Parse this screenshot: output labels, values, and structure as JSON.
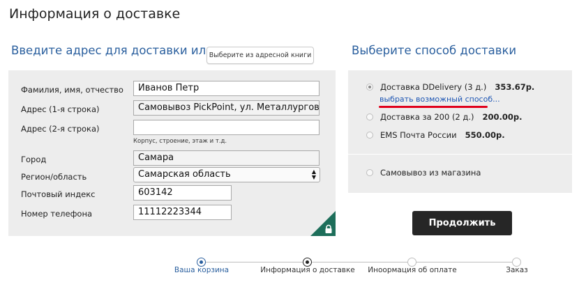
{
  "page_title": "Информация о доставке",
  "address": {
    "heading": "Введите адрес для доставки или",
    "address_book_button": "Выберите из адресной книги",
    "fields": {
      "name": {
        "label": "Фамилия, имя, отчество",
        "value": "Иванов Петр"
      },
      "address1": {
        "label": "Адрес (1-я строка)",
        "value": "Самовывоз PickPoint, ул. Металлургов,"
      },
      "address2": {
        "label": "Адрес (2-я строка)",
        "value": "",
        "hint": "Корпус, строение, этаж и т.д."
      },
      "city": {
        "label": "Город",
        "value": "Самара"
      },
      "region": {
        "label": "Регион/область",
        "value": "Самарская область"
      },
      "zip": {
        "label": "Почтовый индекс",
        "value": "603142"
      },
      "phone": {
        "label": "Номер телефона",
        "value": "11112223344"
      }
    },
    "lock_icon": "lock-icon"
  },
  "shipping": {
    "heading": "Выберите способ доставки",
    "options": [
      {
        "label": "Доставка DDelivery (3 д.)",
        "price": "353.67р.",
        "selected": true
      },
      {
        "label": "Доставка за 200 (2 д.)",
        "price": "200.00р.",
        "selected": false
      },
      {
        "label": "EMS Почта России",
        "price": "550.00р.",
        "selected": false
      },
      {
        "label": "Самовывоз из магазина",
        "price": "",
        "selected": false
      }
    ],
    "choose_link": "выбрать возможный способ...",
    "highlight_color": "#e0001b"
  },
  "continue_button": "Продолжить",
  "progress": {
    "steps": [
      {
        "label": "Ваша корзина",
        "state": "done"
      },
      {
        "label": "Информация о доставке",
        "state": "current"
      },
      {
        "label": "Инoормация об оплате",
        "state": "pending"
      },
      {
        "label": "Заказ",
        "state": "pending"
      }
    ]
  },
  "colors": {
    "accent": "#2a5f9e",
    "button": "#262626",
    "lock_corner": "#1d6e5a"
  }
}
